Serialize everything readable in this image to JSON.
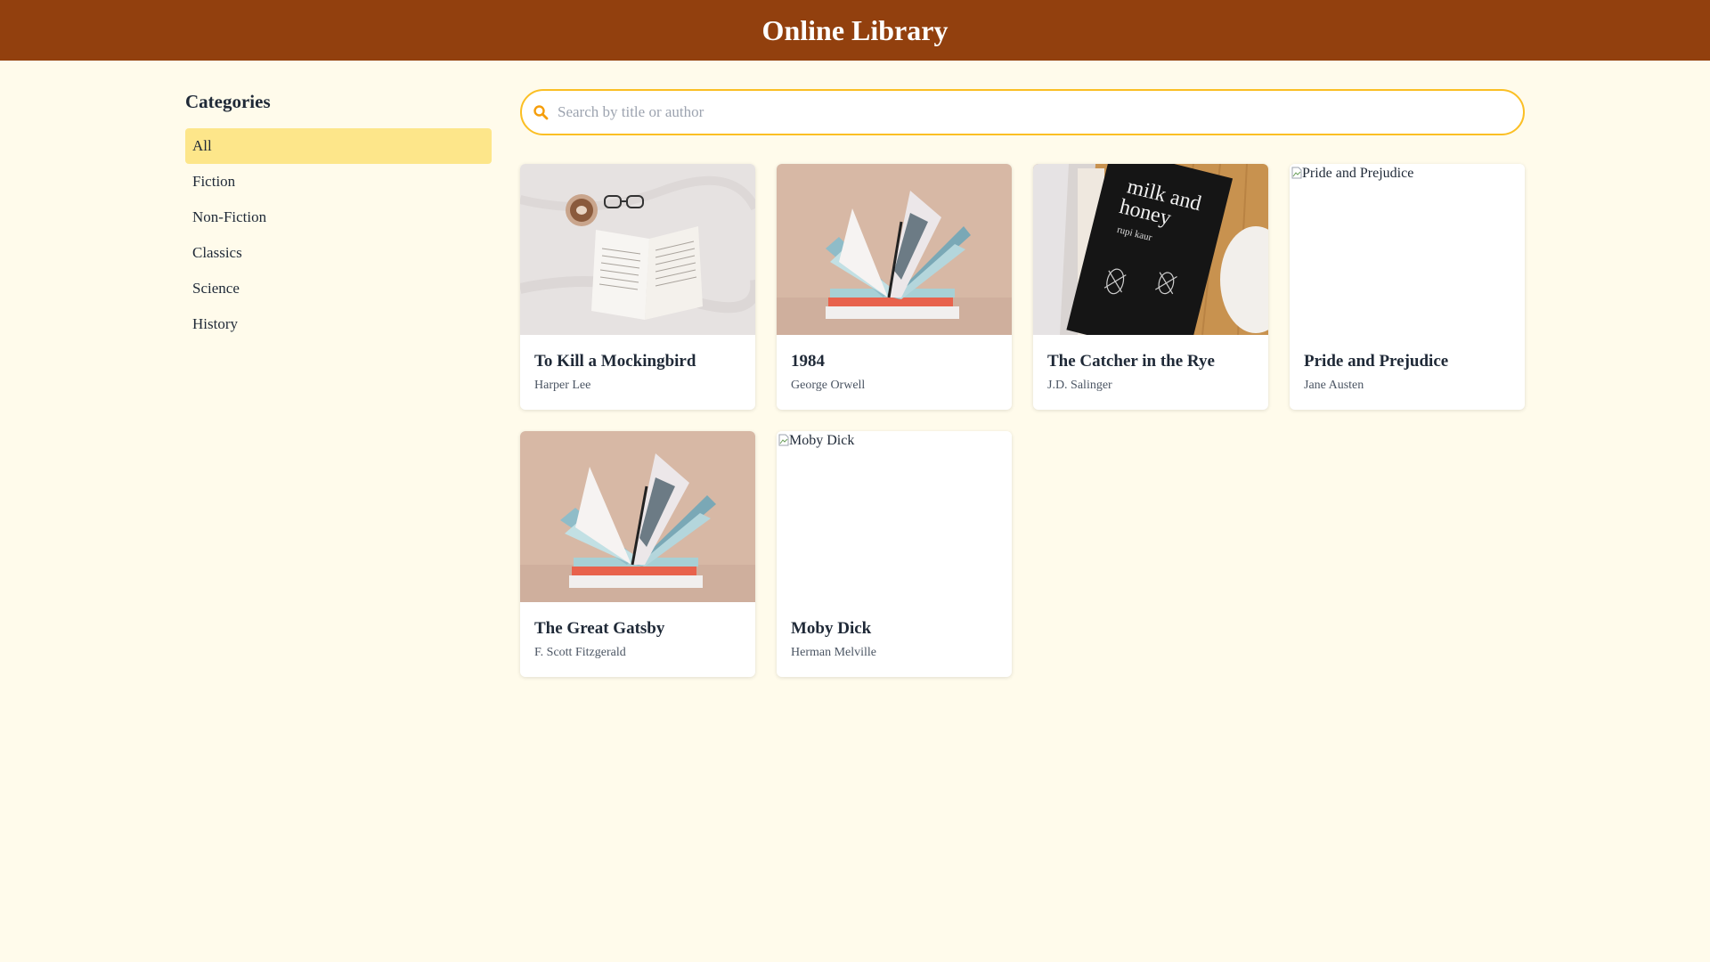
{
  "header": {
    "title": "Online Library"
  },
  "sidebar": {
    "heading": "Categories",
    "items": [
      {
        "label": "All",
        "active": true
      },
      {
        "label": "Fiction",
        "active": false
      },
      {
        "label": "Non-Fiction",
        "active": false
      },
      {
        "label": "Classics",
        "active": false
      },
      {
        "label": "Science",
        "active": false
      },
      {
        "label": "History",
        "active": false
      }
    ]
  },
  "search": {
    "placeholder": "Search by title or author",
    "value": "",
    "icon": "search-icon"
  },
  "books": [
    {
      "title": "To Kill a Mockingbird",
      "author": "Harper Lee",
      "cover": "open-book-with-glasses-and-coffee",
      "image_loaded": true
    },
    {
      "title": "1984",
      "author": "George Orwell",
      "cover": "fanned-open-book",
      "image_loaded": true
    },
    {
      "title": "The Catcher in the Rye",
      "author": "J.D. Salinger",
      "cover": "milk-and-honey-book",
      "cover_text_1": "milk and",
      "cover_text_2": "honey",
      "cover_text_3": "rupi kaur",
      "image_loaded": true
    },
    {
      "title": "Pride and Prejudice",
      "author": "Jane Austen",
      "cover_alt": "Pride and Prejudice",
      "image_loaded": false
    },
    {
      "title": "The Great Gatsby",
      "author": "F. Scott Fitzgerald",
      "cover": "fanned-open-book",
      "image_loaded": true
    },
    {
      "title": "Moby Dick",
      "author": "Herman Melville",
      "cover_alt": "Moby Dick",
      "image_loaded": false
    }
  ],
  "colors": {
    "header_bg": "#92400e",
    "page_bg": "#fffbeb",
    "active_category": "#fde68a",
    "search_border": "#fbbf24"
  }
}
